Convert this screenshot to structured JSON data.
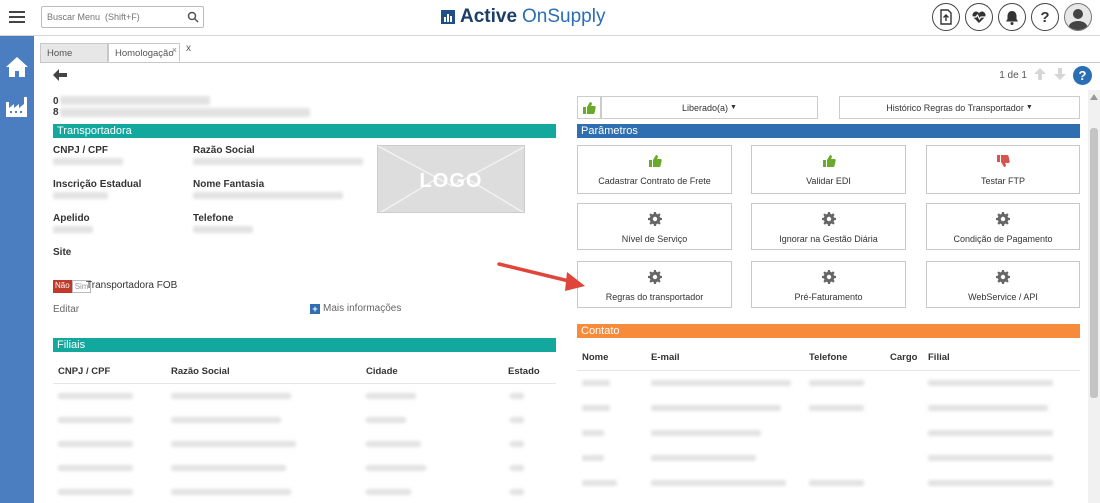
{
  "header": {
    "search_placeholder": "Buscar Menu  (Shift+F)",
    "brand_bold": "Active",
    "brand_light": "OnSupply",
    "icons": [
      "upload-doc-icon",
      "heart-pulse-icon",
      "bell-icon",
      "help-icon",
      "user-avatar-icon"
    ]
  },
  "sidebar": {
    "items": [
      "home-icon",
      "factory-icon"
    ]
  },
  "tabs": [
    {
      "label": "Home",
      "closable": false
    },
    {
      "label": "Homologação",
      "closable": true
    }
  ],
  "tab_extra_close": "x",
  "pager": {
    "label": "1 de 1"
  },
  "id_block": {
    "line1": "0",
    "line2": "8"
  },
  "transportadora": {
    "title": "Transportadora",
    "fields": {
      "cnpj": "CNPJ / CPF",
      "razao_social": "Razão Social",
      "inscricao": "Inscrição Estadual",
      "nome_fantasia": "Nome Fantasia",
      "apelido": "Apelido",
      "telefone": "Telefone",
      "site": "Site"
    },
    "logo_text": "LOGO",
    "toggle_no": "Não",
    "toggle_yes": "Sim",
    "fob_label": "Transportadora FOB",
    "edit": "Editar",
    "more_info": "Mais informações"
  },
  "filiais": {
    "title": "Filiais",
    "columns": [
      "CNPJ / CPF",
      "Razão Social",
      "Cidade",
      "Estado"
    ]
  },
  "status_dropdown": "Liberado(a)",
  "history_dropdown": "Histórico Regras do Transportador",
  "parametros": {
    "title": "Parâmetros",
    "cards": [
      {
        "label": "Cadastrar Contrato de Frete",
        "icon": "thumbs-up-icon"
      },
      {
        "label": "Validar EDI",
        "icon": "thumbs-up-icon"
      },
      {
        "label": "Testar FTP",
        "icon": "thumbs-down-icon"
      },
      {
        "label": "Nível de Serviço",
        "icon": "gear-icon"
      },
      {
        "label": "Ignorar na Gestão Diária",
        "icon": "gear-icon"
      },
      {
        "label": "Condição de Pagamento",
        "icon": "gear-icon"
      },
      {
        "label": "Regras do transportador",
        "icon": "gear-icon"
      },
      {
        "label": "Pré-Faturamento",
        "icon": "gear-icon"
      },
      {
        "label": "WebService / API",
        "icon": "gear-icon"
      }
    ]
  },
  "contato": {
    "title": "Contato",
    "columns": [
      "Nome",
      "E-mail",
      "Telefone",
      "Cargo",
      "Filial"
    ]
  },
  "colors": {
    "teal": "#13a89e",
    "blue": "#2f6fb1",
    "orange": "#f68b3c",
    "green": "#6aaa2a",
    "red": "#d9534f",
    "annotation_arrow": "#e0453a"
  }
}
